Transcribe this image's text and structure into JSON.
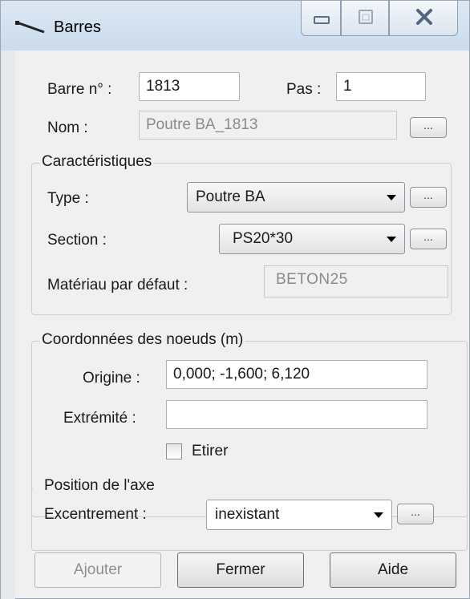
{
  "window": {
    "title": "Barres",
    "icon": "line-element-icon"
  },
  "titlebar_buttons": {
    "minimize": "minimize-icon",
    "maximize": "maximize-icon",
    "close": "close-icon"
  },
  "header": {
    "barre_label": "Barre n° :",
    "barre_value": "1813",
    "pas_label": "Pas :",
    "pas_value": "1",
    "nom_label": "Nom :",
    "nom_value": "Poutre BA_1813",
    "browse": "..."
  },
  "caracteristiques": {
    "title": "Caractéristiques",
    "type_label": "Type :",
    "type_value": "Poutre BA",
    "section_label": "Section :",
    "section_value": "PS20*30",
    "materiau_label": "Matériau par défaut :",
    "materiau_value": "BETON25",
    "browse": "..."
  },
  "coordonnees": {
    "title": "Coordonnées des noeuds (m)",
    "origine_label": "Origine :",
    "origine_value": "0,000; -1,600; 6,120",
    "extremite_label": "Extrémité :",
    "extremite_value": "",
    "etirer_label": "Etirer",
    "etirer_checked": false
  },
  "axe": {
    "title": "Position de l'axe",
    "excentrement_label": "Excentrement :",
    "excentrement_value": "inexistant",
    "browse": "..."
  },
  "buttons": {
    "ajouter": "Ajouter",
    "fermer": "Fermer",
    "aide": "Aide"
  }
}
